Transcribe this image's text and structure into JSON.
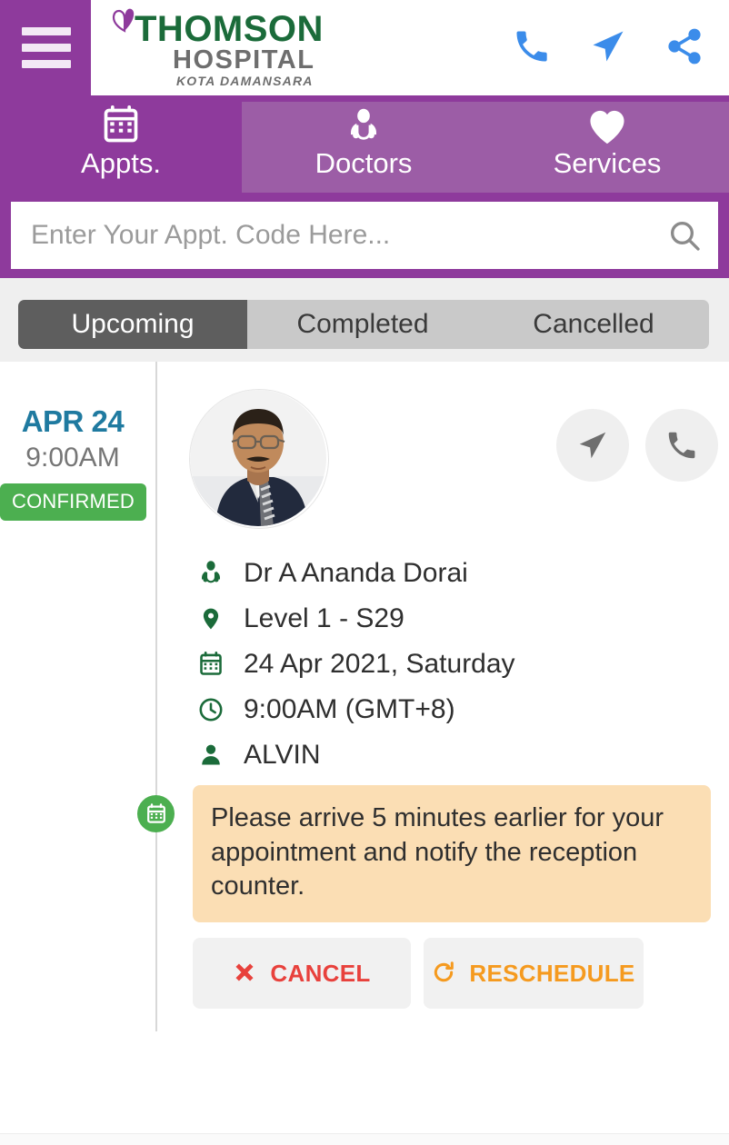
{
  "header": {
    "menu_icon": "hamburger-menu-icon",
    "logo": {
      "mark": "butterfly-icon",
      "line1": "THOMSON",
      "line2": "HOSPITAL",
      "line3": "KOTA DAMANSARA",
      "color_line1": "#1B6B3A",
      "color_line2": "#6E6E6E"
    },
    "actions": [
      {
        "name": "phone-icon",
        "label": "Call"
      },
      {
        "name": "navigate-icon",
        "label": "Directions"
      },
      {
        "name": "share-icon",
        "label": "Share"
      }
    ],
    "action_color": "#3B8CEA",
    "bg_color": "#8E3A9C"
  },
  "nav": {
    "active_index": 0,
    "active_bg": "#8E3A9C",
    "inactive_bg": "#9C5DA6",
    "tabs": [
      {
        "label": "Appts.",
        "icon": "calendar-icon"
      },
      {
        "label": "Doctors",
        "icon": "doctor-icon"
      },
      {
        "label": "Services",
        "icon": "heart-icon"
      }
    ]
  },
  "search": {
    "placeholder": "Enter Your Appt. Code Here...",
    "value": "",
    "icon": "search-icon"
  },
  "filters": {
    "active_index": 0,
    "items": [
      {
        "label": "Upcoming"
      },
      {
        "label": "Completed"
      },
      {
        "label": "Cancelled"
      }
    ]
  },
  "appointment": {
    "date_short": "APR 24",
    "time_short": "9:00AM",
    "status": "CONFIRMED",
    "status_color": "#4CAF50",
    "timeline_icon": "calendar-icon",
    "avatar_alt": "doctor-portrait",
    "card_actions": [
      {
        "name": "navigate-icon",
        "label": "Directions"
      },
      {
        "name": "phone-icon",
        "label": "Call"
      }
    ],
    "details": [
      {
        "icon": "doctor-icon",
        "text": "Dr A Ananda Dorai"
      },
      {
        "icon": "location-pin-icon",
        "text": "Level 1 - S29"
      },
      {
        "icon": "calendar-icon",
        "text": "24 Apr 2021, Saturday"
      },
      {
        "icon": "clock-icon",
        "text": "9:00AM (GMT+8)"
      },
      {
        "icon": "person-icon",
        "text": "ALVIN"
      }
    ],
    "notice": "Please arrive 5 minutes earlier for your appointment and notify the reception counter.",
    "notice_bg": "#FBDEB4",
    "buttons": [
      {
        "label": "CANCEL",
        "icon": "cross-icon",
        "color": "#E8413C"
      },
      {
        "label": "RESCHEDULE",
        "icon": "refresh-icon",
        "color": "#F59A1F"
      }
    ]
  }
}
